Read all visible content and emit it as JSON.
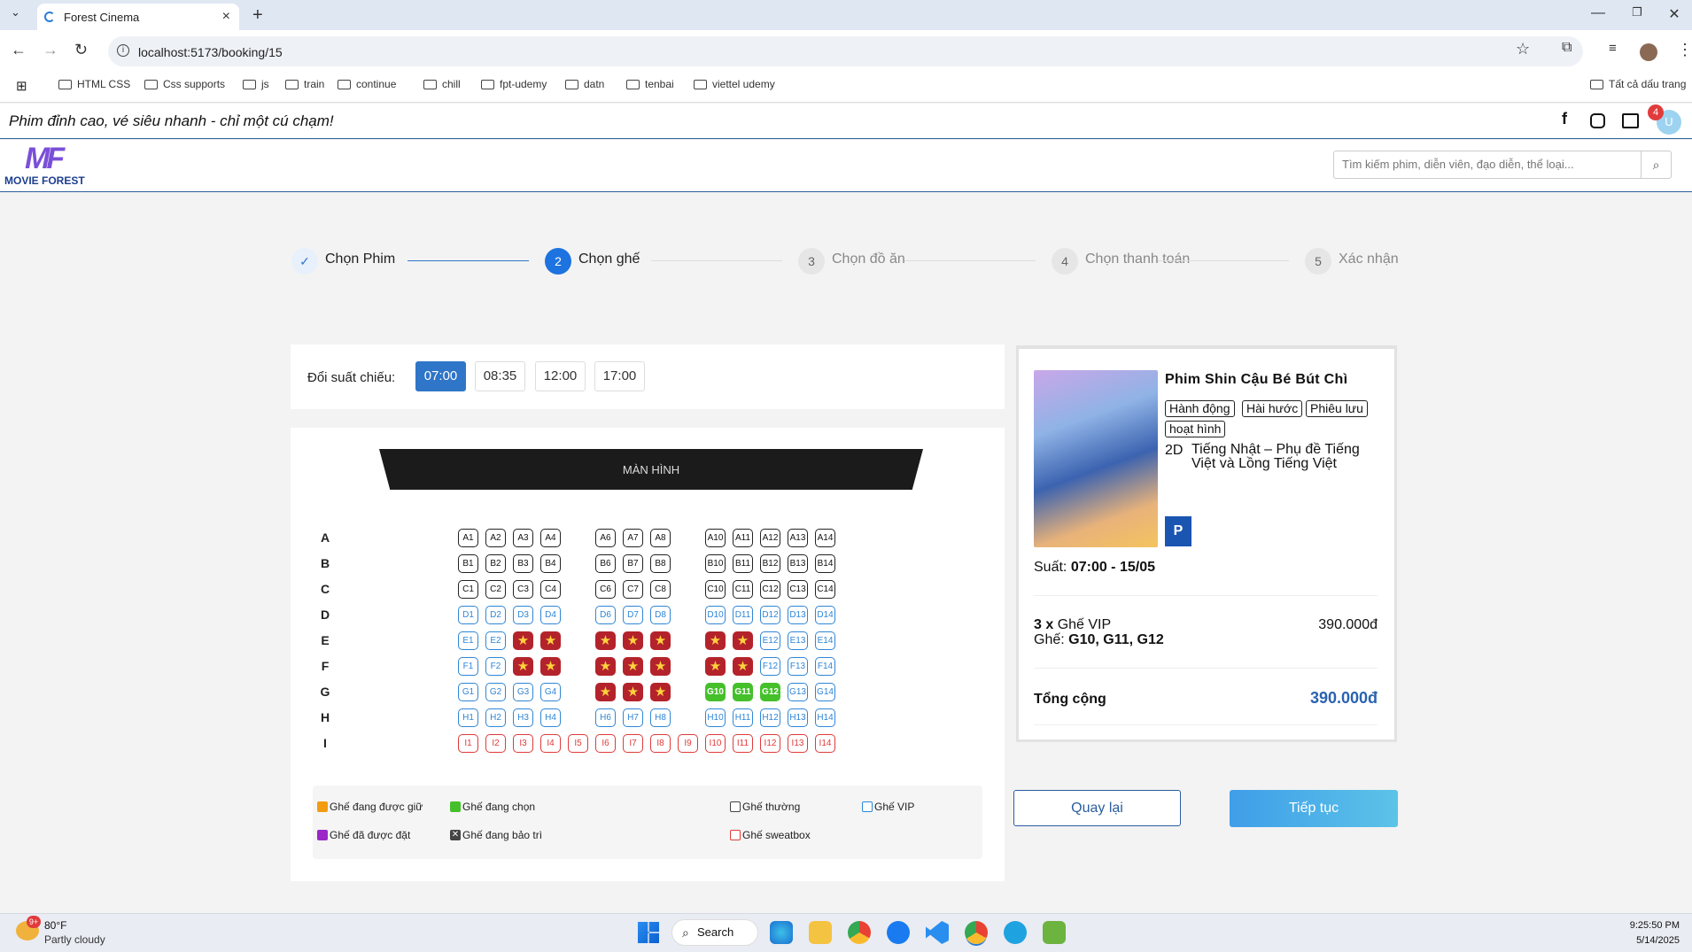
{
  "browser": {
    "tab_title": "Forest Cinema",
    "url": "localhost:5173/booking/15",
    "bookmarks": [
      "HTML CSS",
      "Css supports",
      "js",
      "train",
      "continue",
      "chill",
      "fpt-udemy",
      "datn",
      "tenbai",
      "viettel udemy"
    ],
    "all_bookmarks": "Tất cả dấu trang"
  },
  "site": {
    "slogan": "Phim đỉnh cao, vé siêu nhanh - chỉ một cú chạm!",
    "logo_mark": "MF",
    "logo_text": "MOVIE FOREST",
    "notification_count": "4",
    "avatar_initial": "U",
    "search_placeholder": "Tìm kiếm phim, diễn viên, đạo diễn, thể loại..."
  },
  "steps": [
    {
      "num": "✓",
      "label": "Chọn Phim",
      "state": "done"
    },
    {
      "num": "2",
      "label": "Chọn ghế",
      "state": "active"
    },
    {
      "num": "3",
      "label": "Chọn đồ ăn",
      "state": "todo"
    },
    {
      "num": "4",
      "label": "Chọn thanh toán",
      "state": "todo"
    },
    {
      "num": "5",
      "label": "Xác nhận",
      "state": "todo"
    }
  ],
  "showtimes": {
    "label": "Đổi suất chiếu:",
    "times": [
      "07:00",
      "08:35",
      "12:00",
      "17:00"
    ],
    "selected": "07:00"
  },
  "screen_label": "MÀN HÌNH",
  "seat_rows": [
    "A",
    "B",
    "C",
    "D",
    "E",
    "F",
    "G",
    "H",
    "I"
  ],
  "seat_types": {
    "A": "regular",
    "B": "regular",
    "C": "regular",
    "D": "vip",
    "E": "vip",
    "F": "vip",
    "G": "vip",
    "H": "vip",
    "I": "sweetbox"
  },
  "booked_seats": [
    "E3",
    "E4",
    "E6",
    "E7",
    "E8",
    "E10",
    "E11",
    "F3",
    "F4",
    "F6",
    "F7",
    "F8",
    "F10",
    "F11",
    "G6",
    "G7",
    "G8"
  ],
  "selected_seats": [
    "G10",
    "G11",
    "G12"
  ],
  "legend": [
    {
      "label": "Ghế đang được giữ",
      "color": "#f39c12",
      "style": "fill"
    },
    {
      "label": "Ghế đang chọn",
      "color": "#45c02b",
      "style": "fill"
    },
    {
      "label": "Ghế thường",
      "color": "#444444",
      "style": "outline"
    },
    {
      "label": "Ghế VIP",
      "color": "#2f86d6",
      "style": "outline"
    },
    {
      "label": "Ghế đã được đặt",
      "color": "#9b27c9",
      "style": "fill"
    },
    {
      "label": "Ghế đang bảo trì",
      "color": "#444444",
      "style": "x"
    },
    {
      "label": "Ghế sweatbox",
      "color": "#e03a3a",
      "style": "outline"
    }
  ],
  "summary": {
    "movie_title": "Phim Shin Cậu Bé Bút Chì",
    "genres": [
      "Hành động",
      "Hài hước",
      "Phiêu lưu",
      "hoạt hình"
    ],
    "format": "2D",
    "language": "Tiếng Nhật – Phụ đề Tiếng Việt và Lồng Tiếng Việt",
    "rating": "P",
    "showtime_label": "Suất: ",
    "showtime_value": "07:00 - 15/05",
    "ticket_qty": "3 x",
    "ticket_type": " Ghế VIP",
    "ticket_price": "390.000đ",
    "seats_label": "Ghế: ",
    "seats_value": "G10, G11, G12",
    "total_label": "Tổng cộng",
    "total_value": "390.000đ"
  },
  "buttons": {
    "back": "Quay lại",
    "next": "Tiếp tục"
  },
  "taskbar": {
    "temperature": "80°F",
    "weather": "Partly cloudy",
    "weather_badge": "9+",
    "search": "Search",
    "time": "9:25:50 PM",
    "date": "5/14/2025"
  }
}
